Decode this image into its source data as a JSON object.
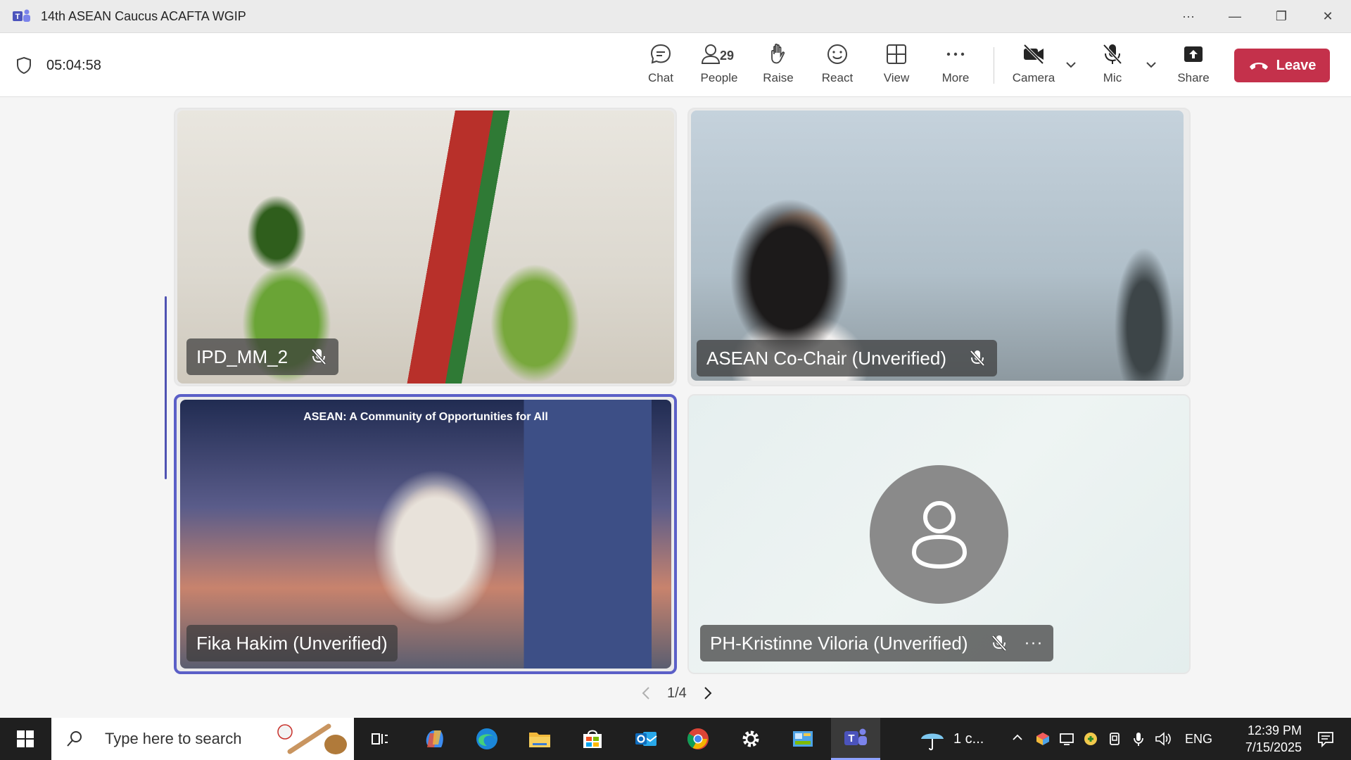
{
  "window": {
    "title": "14th ASEAN Caucus ACAFTA WGIP",
    "controls": {
      "more": "···",
      "minimize": "—",
      "restore": "❐",
      "close": "✕"
    }
  },
  "toolbar": {
    "timer": "05:04:58",
    "chat_label": "Chat",
    "people_label": "People",
    "people_count": "29",
    "raise_label": "Raise",
    "react_label": "React",
    "view_label": "View",
    "more_label": "More",
    "camera_label": "Camera",
    "mic_label": "Mic",
    "share_label": "Share",
    "leave_label": "Leave",
    "leave_color": "#c4314b"
  },
  "participants": [
    {
      "name": "IPD_MM_2",
      "muted": true
    },
    {
      "name": "ASEAN Co-Chair (Unverified)",
      "muted": true
    },
    {
      "name": "Fika Hakim (Unverified)",
      "muted": false,
      "active_speaker": true,
      "background_banner": "ASEAN: A Community of Opportunities for All"
    },
    {
      "name": "PH-Kristinne Viloria (Unverified)",
      "muted": true,
      "avatar": "person-icon"
    }
  ],
  "pager": {
    "label": "1/4"
  },
  "taskbar": {
    "search_placeholder": "Type here to search",
    "weather": "1 c...",
    "language": "ENG",
    "time": "12:39 PM",
    "date": "7/15/2025"
  },
  "accent_color": "#5b5fc7"
}
